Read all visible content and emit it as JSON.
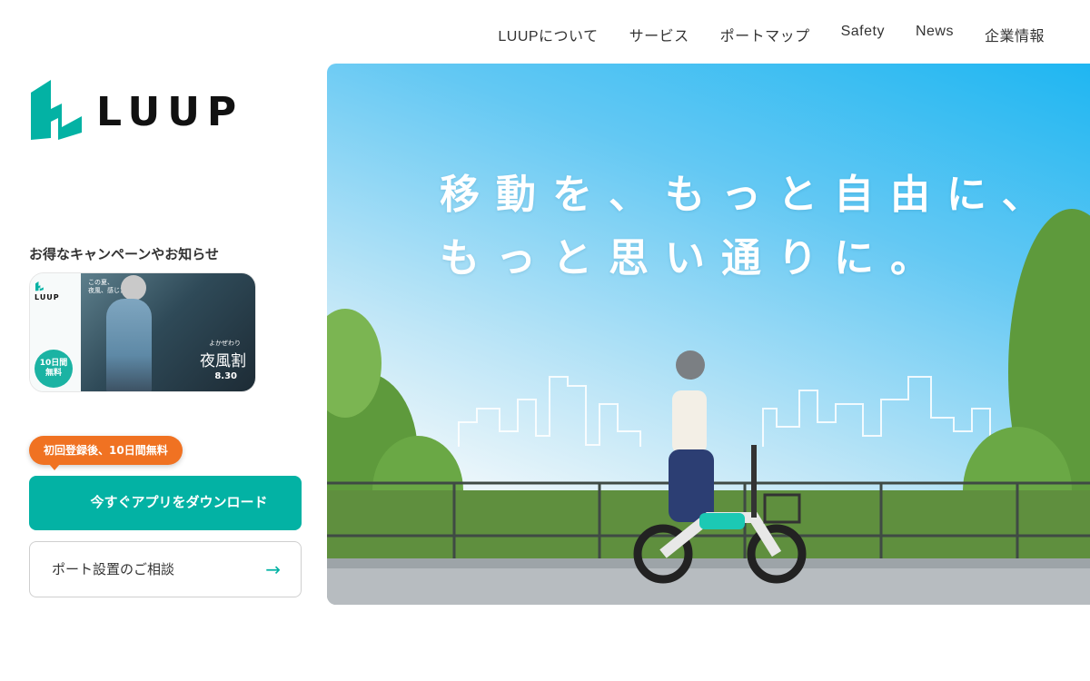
{
  "nav": {
    "items": [
      "LUUPについて",
      "サービス",
      "ポートマップ",
      "Safety",
      "News",
      "企業情報"
    ]
  },
  "logo": {
    "text": "LUUP"
  },
  "campaign": {
    "title": "お得なキャンペーンやお知らせ",
    "card": {
      "logo_text": "LUUP",
      "small_text": "この夏、\n夜風、感じた？",
      "circle_text": "10日間\n無料",
      "sub_text": "よかぜわり",
      "main_text": "夜風割",
      "date_text": "8.30"
    }
  },
  "badge": {
    "label": "初回登録後、10日間無料"
  },
  "buttons": {
    "download_label": "今すぐアプリをダウンロード",
    "port_label": "ポート設置のご相談",
    "port_arrow": "→"
  },
  "hero": {
    "line1": "移動を、もっと自由に、",
    "line2": "もっと思い通りに。"
  },
  "colors": {
    "accent": "#03b2a4",
    "badge": "#f07222",
    "sky": "#1fb6f2"
  },
  "icons": {
    "logo": "luup-logo-icon",
    "arrow": "arrow-right-icon"
  }
}
